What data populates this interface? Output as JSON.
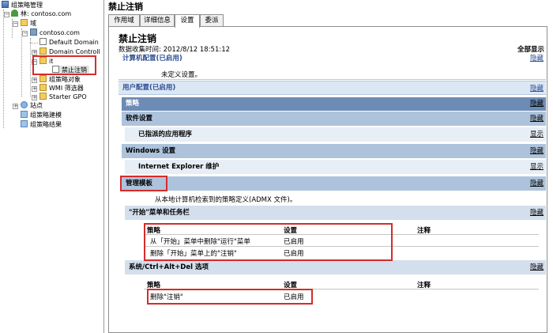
{
  "tree": {
    "root": "组策略管理",
    "forest": "林: contoso.com",
    "domains": "域",
    "domain": "contoso.com",
    "default_domain": "Default Domain",
    "domain_controllers": "Domain Controll",
    "ou_it": "it",
    "gpo_link": "禁止注销",
    "gpo_objects": "组策略对象",
    "wmi_filters": "WMI 筛选器",
    "starter_gpo": "Starter GPO",
    "sites": "站点",
    "modeling": "组策略建模",
    "results": "组策略结果"
  },
  "header": {
    "title": "禁止注销"
  },
  "tabs": [
    "作用域",
    "详细信息",
    "设置",
    "委派"
  ],
  "active_tab": "设置",
  "report": {
    "title": "禁止注销",
    "data_collected": "数据收集时间: 2012/8/12 18:51:12",
    "show_all": "全部显示",
    "computer_config": "计算机配置(已启用)",
    "hide": "隐藏",
    "show": "显示",
    "not_defined": "未定义设置。",
    "user_config": "用户配置(已启用)",
    "policies": "策略",
    "software_settings": "软件设置",
    "assigned_apps": "已指派的应用程序",
    "windows_settings": "Windows 设置",
    "ie_maintenance": "Internet Explorer 维护",
    "admin_templates": "管理模板",
    "admx_note": "从本地计算机检索到的策略定义(ADMX 文件)。",
    "start_menu": "\"开始\"菜单和任务栏",
    "col_policy": "策略",
    "col_setting": "设置",
    "col_comment": "注释",
    "start_rows": [
      {
        "policy": "从「开始」菜单中删除\"运行\"菜单",
        "setting": "已启用"
      },
      {
        "policy": "删除「开始」菜单上的\"注销\"",
        "setting": "已启用"
      }
    ],
    "system_section": "系统/Ctrl+Alt+Del 选项",
    "system_rows": [
      {
        "policy": "删除\"注销\"",
        "setting": "已启用"
      }
    ]
  },
  "colors": {
    "bar_dark": "#6d8cb5",
    "bar_mid": "#adc3dc",
    "bar_light": "#d3dfed",
    "highlight_box": "#d62b2b",
    "heading_blue": "#2a4c8f"
  }
}
